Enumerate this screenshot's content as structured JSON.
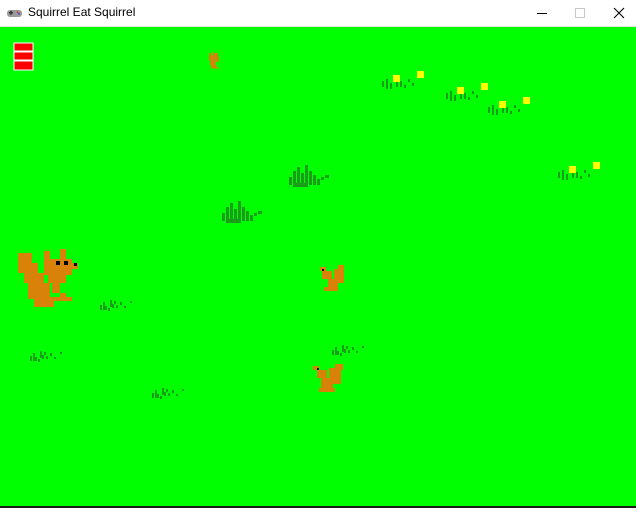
{
  "window": {
    "title": "Squirrel Eat Squirrel",
    "controls": {
      "minimize_icon": "minimize-icon",
      "maximize_icon": "maximize-icon",
      "close_icon": "close-icon"
    }
  },
  "game": {
    "background_color": "#00ff00",
    "grass_color": "#1a9e1a",
    "squirrel_color": "#d9820a",
    "health_color": "#ff0000",
    "flower_color": "#ffff00",
    "health_bars": 3
  }
}
